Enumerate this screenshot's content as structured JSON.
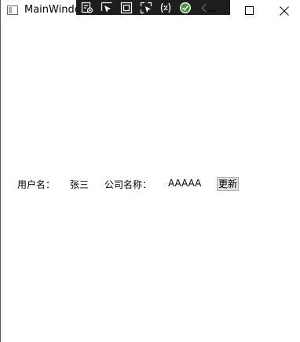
{
  "window": {
    "title": "MainWindow"
  },
  "devtoolbar": {
    "icons": [
      "live-visual-tree-icon",
      "select-element-icon",
      "display-layout-adorners-icon",
      "track-focus-icon",
      "binding-failures-icon",
      "hot-reload-ok-icon",
      "collapse-chevron-icon"
    ]
  },
  "form": {
    "username_label": "用户名：",
    "username_value": "张三",
    "company_label": "公司名称：",
    "company_value": "AAAAA",
    "update_button": "更新"
  }
}
